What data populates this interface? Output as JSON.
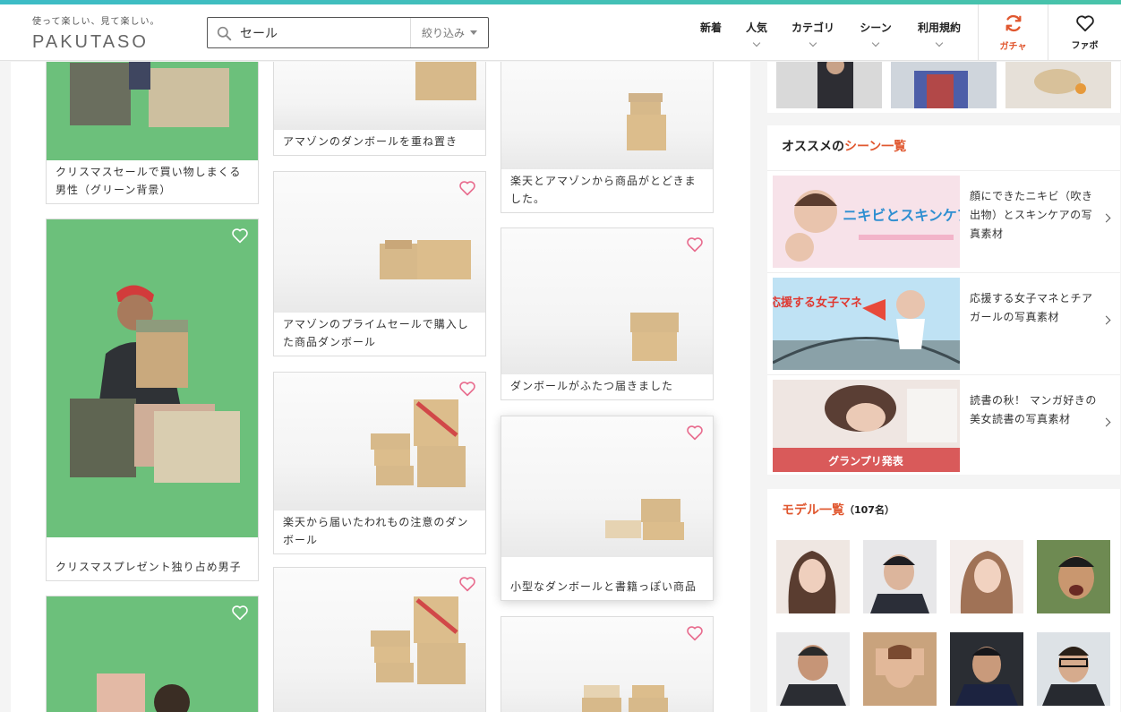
{
  "site": {
    "logo_tagline": "使って楽しい、見て楽しい。",
    "logo_word": "PAKUTASO"
  },
  "search": {
    "value": "セール",
    "filter_label": "絞り込み"
  },
  "nav": {
    "items": [
      {
        "label": "新着",
        "has_dropdown": false
      },
      {
        "label": "人気",
        "has_dropdown": true
      },
      {
        "label": "カテゴリ",
        "has_dropdown": true
      },
      {
        "label": "シーン",
        "has_dropdown": true
      },
      {
        "label": "利用規約",
        "has_dropdown": true
      }
    ],
    "gacha_label": "ガチャ",
    "fav_label": "ファボ"
  },
  "photos": {
    "col1": [
      {
        "caption": "クリスマスセールで買い物しまくる男性（グリーン背景）"
      },
      {
        "caption": "クリスマスプレゼント独り占め男子"
      },
      {
        "caption": ""
      }
    ],
    "col2": [
      {
        "caption": "アマゾンのダンボールを重ね置き"
      },
      {
        "caption": "アマゾンのプライムセールで購入した商品ダンボール"
      },
      {
        "caption": "楽天から届いたわれもの注意のダンボール"
      },
      {
        "caption": ""
      }
    ],
    "col3": [
      {
        "caption": "楽天とアマゾンから商品がとどきました。"
      },
      {
        "caption": "ダンボールがふたつ届きました"
      },
      {
        "caption": "小型なダンボールと書籍っぽい商品"
      },
      {
        "caption": ""
      }
    ]
  },
  "sidebar": {
    "scenes": {
      "title_prefix": "オススメの",
      "title_accent": "シーン一覧",
      "items": [
        {
          "text": "顔にできたニキビ（吹き出物）とスキンケアの写真素材",
          "banner_text": "ニキビとスキンケア"
        },
        {
          "text": "応援する女子マネとチアガールの写真素材",
          "banner_text": "応援する女子マネ"
        },
        {
          "text": "読書の秋！ マンガ好きの美女読書の写真素材",
          "banner_text": "グランプリ発表"
        }
      ]
    },
    "models": {
      "title": "モデル一覧",
      "count": "（107名）"
    }
  },
  "colors": {
    "accent": "#e0572f",
    "heart": "#e86c8e",
    "green_screen": "#6cc07b",
    "topbar": "#3dbcc6"
  }
}
